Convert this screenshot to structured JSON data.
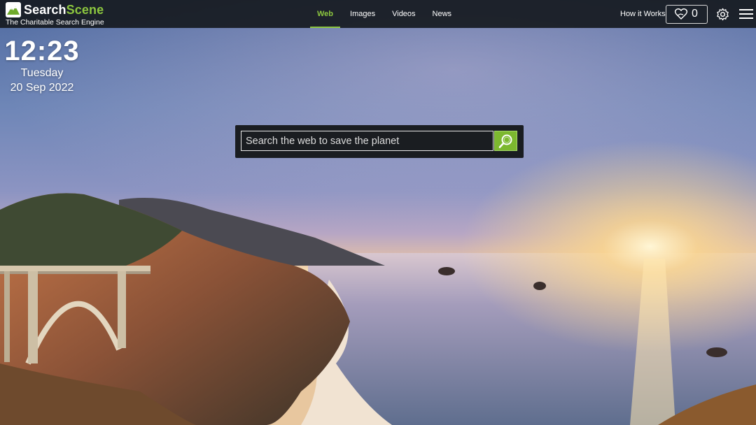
{
  "brand": {
    "name_part1": "Search",
    "name_part2": "Scene",
    "tagline": "The Charitable Search Engine",
    "accent_color": "#8cc63f"
  },
  "nav": {
    "tabs": [
      {
        "label": "Web",
        "active": true
      },
      {
        "label": "Images",
        "active": false
      },
      {
        "label": "Videos",
        "active": false
      },
      {
        "label": "News",
        "active": false
      }
    ]
  },
  "header": {
    "how_it_works": "How it Works",
    "donation_count": "0",
    "icons": [
      "heart-hand-icon",
      "gear-icon",
      "hamburger-menu-icon"
    ]
  },
  "clock": {
    "time": "12:23",
    "day": "Tuesday",
    "date": "20 Sep 2022"
  },
  "search": {
    "placeholder": "Search the web to save the planet",
    "value": "",
    "button_icon": "magnifier-icon"
  },
  "background": {
    "description_icon": "coastal-sunset-photo"
  }
}
